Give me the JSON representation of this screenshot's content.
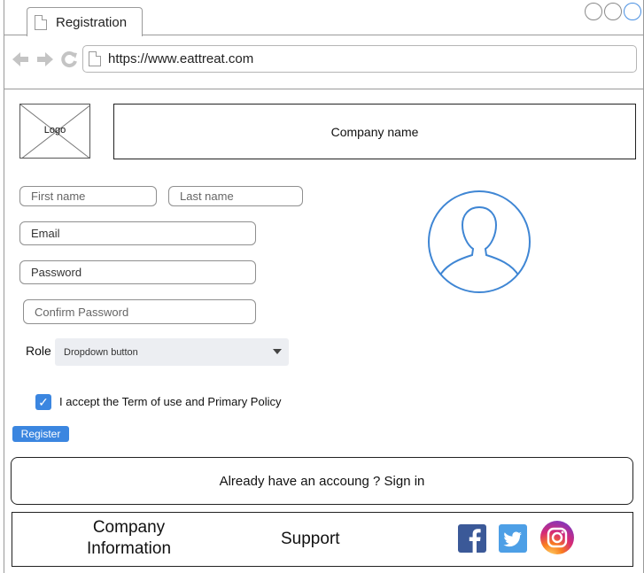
{
  "browser": {
    "tab_title": "Registration",
    "url": "https://www.eattreat.com",
    "icons": [
      "back-arrow-icon",
      "forward-arrow-icon",
      "reload-icon",
      "page-icon"
    ]
  },
  "header": {
    "logo_label": "Logo",
    "company_name": "Company name"
  },
  "form": {
    "first_name_placeholder": "First name",
    "last_name_placeholder": "Last name",
    "email_label": "Email",
    "password_label": "Password",
    "confirm_password_placeholder": "Confirm Password",
    "role_label": "Role",
    "role_dropdown_value": "Dropdown button",
    "accept_checked": true,
    "accept_text": "I accept the Term of use and Primary Policy",
    "register_button": "Register"
  },
  "signin": {
    "text": "Already have an accoung ? Sign in"
  },
  "footer": {
    "company_information": "Company Information",
    "support": "Support",
    "social_icons": [
      "facebook-icon",
      "twitter-icon",
      "instagram-icon"
    ]
  },
  "colors": {
    "accent": "#3b86e0",
    "avatar_stroke": "#3f86d4",
    "facebook": "#3b5998",
    "twitter": "#4d9fe6"
  }
}
